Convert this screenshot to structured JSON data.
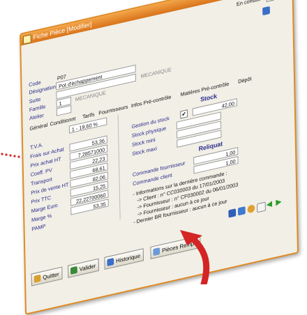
{
  "window": {
    "title": "Fiche Pièce [Modifier]",
    "close_label": "X"
  },
  "top_right": {
    "en_consult_label": "En consult"
  },
  "header": {
    "code_label": "Code",
    "code_value": "P07",
    "designation_label": "Désignation",
    "designation_value": "Pot d'échappement",
    "suite_label": "Suite",
    "suite_value": "1",
    "famille_label": "Famille",
    "famille_value": "1",
    "famille_desc": "MECANIQUE",
    "mecanique_label": "MECANIQUE",
    "atelier_label": "Atelier"
  },
  "tabs": [
    "Général",
    "Conditionnt",
    "Tarifs",
    "Fournisseurs",
    "Infos Pré-contrôle",
    "Matières Pré-contrôle",
    "Dépôt"
  ],
  "left": {
    "taux_value": "1 - 19,60 %",
    "rows": [
      {
        "label": "T.V.A.",
        "value": ""
      },
      {
        "label": "Frais sur Achat",
        "value": "53,36"
      },
      {
        "label": "Prix achat HT",
        "value": "7,28571000"
      },
      {
        "label": "Coeff. PV",
        "value": "22,23"
      },
      {
        "label": "Transport",
        "value": "68,61"
      },
      {
        "label": "Prix de vente HT",
        "value": "82,06"
      },
      {
        "label": "Prix TTC",
        "value": "15,25"
      },
      {
        "label": "Marge Euro",
        "value": "22,22700060"
      },
      {
        "label": "Marge %",
        "value": "53,35"
      },
      {
        "label": "PAMP",
        "value": ""
      }
    ]
  },
  "stock": {
    "title": "Stock",
    "gestion_label": "Gestion du stock",
    "gestion_checked": "✔",
    "gestion_value": "42,00",
    "physique_label": "Stock physique",
    "mini_label": "Stock mini",
    "maxi_label": "Stock maxi"
  },
  "reliquat": {
    "title": "Reliquat",
    "fournisseur_label": "Commande fournisseur",
    "fournisseur_value": "1,00",
    "client_label": "Commande client",
    "client_value": "1,00"
  },
  "info": {
    "line1": "- Informations sur la dernière commande :",
    "line2": "-> Client : n° CC030003 du 17/01/2003",
    "line3": "-> Fournisseur : n° CF030002 du 06/01/2003",
    "line4": "-> Fournisseur : aucun à ce jour",
    "line5": "- Dernier BR fournisseur : aucun à ce jour"
  },
  "buttons": {
    "quitter": "Quitter",
    "valider": "Valider",
    "historique": "Historique",
    "pieces": "Pièces Rempl."
  },
  "colors": {
    "accent": "#e08a22",
    "arrow": "#d42424",
    "dots": "#d42424"
  }
}
